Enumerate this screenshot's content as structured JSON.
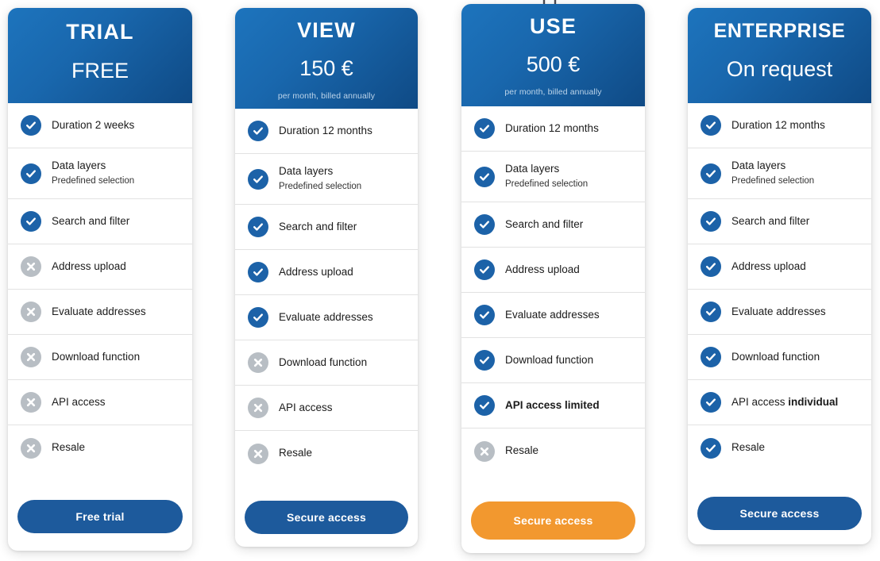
{
  "colors": {
    "header_gradient_start": "#1d74bd",
    "header_gradient_end": "#0f4a85",
    "check_blue": "#1c62a8",
    "cross_grey": "#b8bec4",
    "cta_primary": "#1d5a9c",
    "cta_accent": "#f2982f",
    "page_background": "#ffffff",
    "row_divider": "#e2e2e2",
    "note_text": "#bcd4ea"
  },
  "icons": {
    "check": "check-circle-icon",
    "cross": "cross-circle-icon",
    "pin": "pin-marker-icon"
  },
  "plans": [
    {
      "id": "trial",
      "name": "TRIAL",
      "price": "FREE",
      "note": "",
      "highlighted": false,
      "cta": {
        "label": "Free trial",
        "style": "primary"
      },
      "features": [
        {
          "label": "Duration 2 weeks",
          "sub": "",
          "state": "yes"
        },
        {
          "label": "Data layers",
          "sub": "Predefined selection",
          "state": "yes"
        },
        {
          "label": "Search and filter",
          "sub": "",
          "state": "yes"
        },
        {
          "label": "Address upload",
          "sub": "",
          "state": "no"
        },
        {
          "label": "Evaluate addresses",
          "sub": "",
          "state": "no"
        },
        {
          "label": "Download function",
          "sub": "",
          "state": "no"
        },
        {
          "label": "API access",
          "sub": "",
          "state": "no"
        },
        {
          "label": "Resale",
          "sub": "",
          "state": "no"
        }
      ]
    },
    {
      "id": "view",
      "name": "VIEW",
      "price": "150 €",
      "note": "per month, billed annually",
      "highlighted": false,
      "cta": {
        "label": "Secure access",
        "style": "primary"
      },
      "features": [
        {
          "label": "Duration 12 months",
          "sub": "",
          "state": "yes"
        },
        {
          "label": "Data layers",
          "sub": "Predefined selection",
          "state": "yes"
        },
        {
          "label": "Search and filter",
          "sub": "",
          "state": "yes"
        },
        {
          "label": "Address upload",
          "sub": "",
          "state": "yes"
        },
        {
          "label": "Evaluate addresses",
          "sub": "",
          "state": "yes"
        },
        {
          "label": "Download function",
          "sub": "",
          "state": "no"
        },
        {
          "label": "API access",
          "sub": "",
          "state": "no"
        },
        {
          "label": "Resale",
          "sub": "",
          "state": "no"
        }
      ]
    },
    {
      "id": "use",
      "name": "USE",
      "price": "500 €",
      "note": "per month, billed annually",
      "highlighted": true,
      "cta": {
        "label": "Secure access",
        "style": "accent"
      },
      "features": [
        {
          "label": "Duration 12 months",
          "sub": "",
          "state": "yes"
        },
        {
          "label": "Data layers",
          "sub": "Predefined selection",
          "state": "yes"
        },
        {
          "label": "Search and filter",
          "sub": "",
          "state": "yes"
        },
        {
          "label": "Address upload",
          "sub": "",
          "state": "yes"
        },
        {
          "label": "Evaluate addresses",
          "sub": "",
          "state": "yes"
        },
        {
          "label": "Download function",
          "sub": "",
          "state": "yes"
        },
        {
          "label": "API access limited",
          "sub": "",
          "state": "yes",
          "bold": "API access limited"
        },
        {
          "label": "Resale",
          "sub": "",
          "state": "no"
        }
      ]
    },
    {
      "id": "enterprise",
      "name": "ENTERPRISE",
      "price": "On request",
      "note": "",
      "highlighted": false,
      "cta": {
        "label": "Secure access",
        "style": "primary"
      },
      "features": [
        {
          "label": "Duration 12 months",
          "sub": "",
          "state": "yes"
        },
        {
          "label": "Data layers",
          "sub": "Predefined selection",
          "state": "yes"
        },
        {
          "label": "Search and filter",
          "sub": "",
          "state": "yes"
        },
        {
          "label": "Address upload",
          "sub": "",
          "state": "yes"
        },
        {
          "label": "Evaluate addresses",
          "sub": "",
          "state": "yes"
        },
        {
          "label": "Download function",
          "sub": "",
          "state": "yes"
        },
        {
          "label": "API access individual",
          "sub": "",
          "state": "yes",
          "bold": "individual"
        },
        {
          "label": "Resale",
          "sub": "",
          "state": "yes"
        }
      ]
    }
  ]
}
